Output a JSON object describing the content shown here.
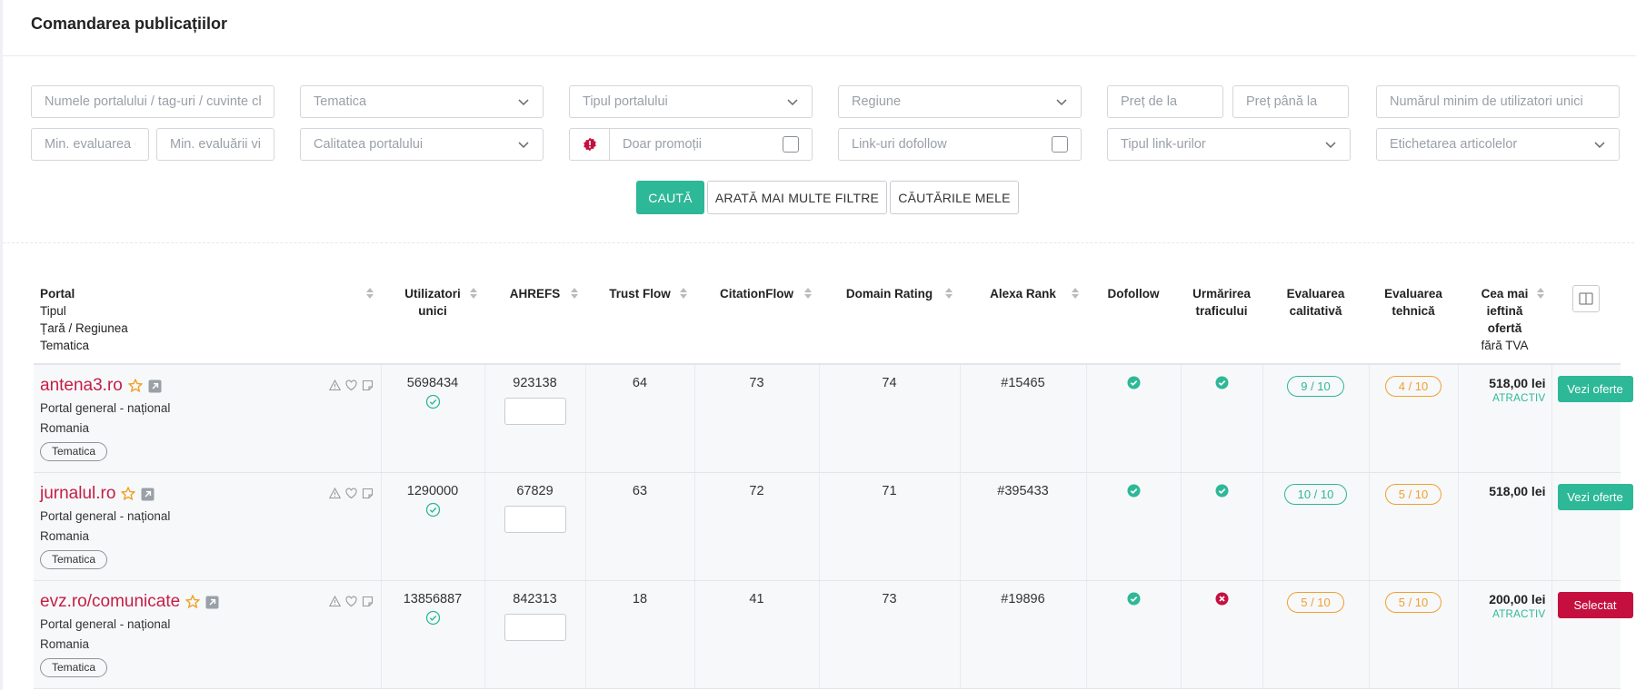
{
  "page": {
    "title": "Comandarea publicațiilor"
  },
  "filters": {
    "portal_name": "Numele portalului / tag-uri / cuvinte cheie",
    "tematica": "Tematica",
    "tip_portal": "Tipul portalului",
    "regiune": "Regiune",
    "pret_de_la": "Preț de la",
    "pret_pana_la": "Preț până la",
    "min_users": "Numărul minim de utilizatori unici",
    "min_eval_cal": "Min. evaluarea calitativă",
    "min_eval_vis": "Min. evaluării vizuale",
    "calitate": "Calitatea portalului",
    "doar_promotii": "Doar promoții",
    "dofollow": "Link-uri dofollow",
    "tip_link": "Tipul link-urilor",
    "etichetare": "Etichetarea articolelor"
  },
  "actions": {
    "search": "CAUTĂ",
    "more_filters": "ARATĂ MAI MULTE FILTRE",
    "my_searches": "CĂUTĂRILE MELE"
  },
  "table": {
    "headers": {
      "portal": "Portal",
      "tipul": "Tipul",
      "tara": "Țară / Regiunea",
      "tematica": "Tematica",
      "users_1": "Utilizatori",
      "users_2": "unici",
      "ahrefs": "AHREFS",
      "trust_flow": "Trust Flow",
      "citation_flow": "CitationFlow",
      "domain_rating": "Domain Rating",
      "alexa": "Alexa Rank",
      "dofollow": "Dofollow",
      "urm_1": "Urmărirea",
      "urm_2": "traficului",
      "eval_cal_1": "Evaluarea",
      "eval_cal_2": "calitativă",
      "eval_teh_1": "Evaluarea",
      "eval_teh_2": "tehnică",
      "price_1": "Cea mai",
      "price_2": "ieftină",
      "price_3": "ofertă",
      "price_4": "fără TVA"
    },
    "rows": [
      {
        "name": "antena3.ro",
        "type": "Portal general - național",
        "country": "Romania",
        "tag": "Tematica",
        "users": "5698434",
        "ahrefs": "923138",
        "trust_flow": "64",
        "citation_flow": "73",
        "domain_rating": "74",
        "alexa": "#15465",
        "qual": "9 / 10",
        "tech": "4 / 10",
        "price": "518,00 lei",
        "atractiv": "ATRACTIV",
        "button": "Vezi oferte"
      },
      {
        "name": "jurnalul.ro",
        "type": "Portal general - național",
        "country": "Romania",
        "tag": "Tematica",
        "users": "1290000",
        "ahrefs": "67829",
        "trust_flow": "63",
        "citation_flow": "72",
        "domain_rating": "71",
        "alexa": "#395433",
        "qual": "10 / 10",
        "tech": "5 / 10",
        "price": "518,00 lei",
        "atractiv": "",
        "button": "Vezi oferte"
      },
      {
        "name": "evz.ro/comunicate",
        "type": "Portal general - național",
        "country": "Romania",
        "tag": "Tematica",
        "users": "13856887",
        "ahrefs": "842313",
        "trust_flow": "18",
        "citation_flow": "41",
        "domain_rating": "73",
        "alexa": "#19896",
        "qual": "5 / 10",
        "tech": "5 / 10",
        "price": "200,00 lei",
        "atractiv": "ATRACTIV",
        "button": "Selectat"
      }
    ],
    "ahrefs_logo": {
      "a": "a",
      "rest": "hrefs"
    }
  },
  "colors": {
    "accent": "#2db897",
    "brand_red": "#c51e45",
    "selected": "#c5103f",
    "orange": "#f0a030"
  },
  "icons": [
    "chevron-down-icon",
    "promo-badge-icon",
    "star-icon",
    "external-link-icon",
    "warning-icon",
    "heart-icon",
    "note-icon",
    "verified-check-icon",
    "check-circle-icon",
    "x-circle-icon",
    "sort-icon",
    "columns-icon"
  ]
}
